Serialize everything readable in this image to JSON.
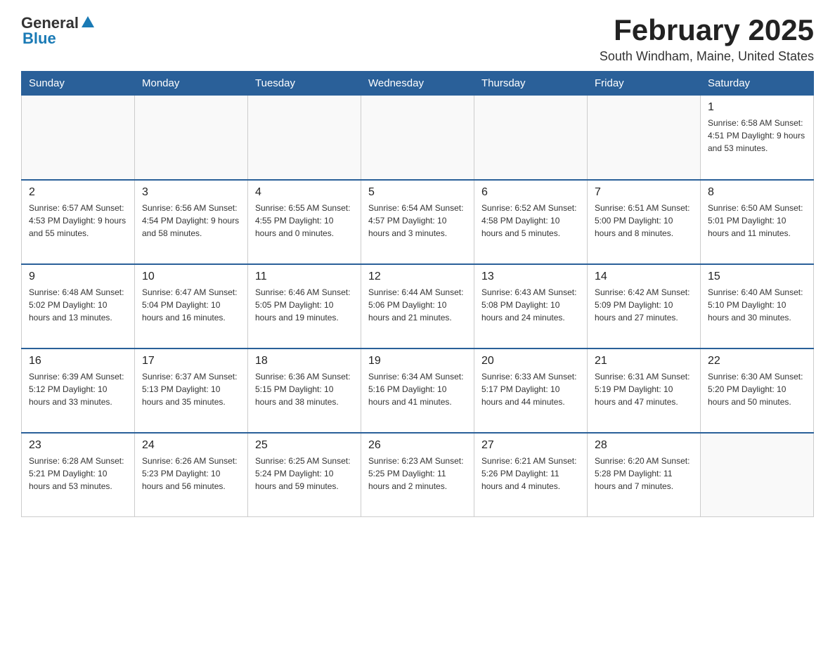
{
  "header": {
    "logo": {
      "general": "General",
      "blue": "Blue"
    },
    "title": "February 2025",
    "location": "South Windham, Maine, United States"
  },
  "calendar": {
    "days_of_week": [
      "Sunday",
      "Monday",
      "Tuesday",
      "Wednesday",
      "Thursday",
      "Friday",
      "Saturday"
    ],
    "weeks": [
      [
        {
          "day": "",
          "info": ""
        },
        {
          "day": "",
          "info": ""
        },
        {
          "day": "",
          "info": ""
        },
        {
          "day": "",
          "info": ""
        },
        {
          "day": "",
          "info": ""
        },
        {
          "day": "",
          "info": ""
        },
        {
          "day": "1",
          "info": "Sunrise: 6:58 AM\nSunset: 4:51 PM\nDaylight: 9 hours\nand 53 minutes."
        }
      ],
      [
        {
          "day": "2",
          "info": "Sunrise: 6:57 AM\nSunset: 4:53 PM\nDaylight: 9 hours\nand 55 minutes."
        },
        {
          "day": "3",
          "info": "Sunrise: 6:56 AM\nSunset: 4:54 PM\nDaylight: 9 hours\nand 58 minutes."
        },
        {
          "day": "4",
          "info": "Sunrise: 6:55 AM\nSunset: 4:55 PM\nDaylight: 10 hours\nand 0 minutes."
        },
        {
          "day": "5",
          "info": "Sunrise: 6:54 AM\nSunset: 4:57 PM\nDaylight: 10 hours\nand 3 minutes."
        },
        {
          "day": "6",
          "info": "Sunrise: 6:52 AM\nSunset: 4:58 PM\nDaylight: 10 hours\nand 5 minutes."
        },
        {
          "day": "7",
          "info": "Sunrise: 6:51 AM\nSunset: 5:00 PM\nDaylight: 10 hours\nand 8 minutes."
        },
        {
          "day": "8",
          "info": "Sunrise: 6:50 AM\nSunset: 5:01 PM\nDaylight: 10 hours\nand 11 minutes."
        }
      ],
      [
        {
          "day": "9",
          "info": "Sunrise: 6:48 AM\nSunset: 5:02 PM\nDaylight: 10 hours\nand 13 minutes."
        },
        {
          "day": "10",
          "info": "Sunrise: 6:47 AM\nSunset: 5:04 PM\nDaylight: 10 hours\nand 16 minutes."
        },
        {
          "day": "11",
          "info": "Sunrise: 6:46 AM\nSunset: 5:05 PM\nDaylight: 10 hours\nand 19 minutes."
        },
        {
          "day": "12",
          "info": "Sunrise: 6:44 AM\nSunset: 5:06 PM\nDaylight: 10 hours\nand 21 minutes."
        },
        {
          "day": "13",
          "info": "Sunrise: 6:43 AM\nSunset: 5:08 PM\nDaylight: 10 hours\nand 24 minutes."
        },
        {
          "day": "14",
          "info": "Sunrise: 6:42 AM\nSunset: 5:09 PM\nDaylight: 10 hours\nand 27 minutes."
        },
        {
          "day": "15",
          "info": "Sunrise: 6:40 AM\nSunset: 5:10 PM\nDaylight: 10 hours\nand 30 minutes."
        }
      ],
      [
        {
          "day": "16",
          "info": "Sunrise: 6:39 AM\nSunset: 5:12 PM\nDaylight: 10 hours\nand 33 minutes."
        },
        {
          "day": "17",
          "info": "Sunrise: 6:37 AM\nSunset: 5:13 PM\nDaylight: 10 hours\nand 35 minutes."
        },
        {
          "day": "18",
          "info": "Sunrise: 6:36 AM\nSunset: 5:15 PM\nDaylight: 10 hours\nand 38 minutes."
        },
        {
          "day": "19",
          "info": "Sunrise: 6:34 AM\nSunset: 5:16 PM\nDaylight: 10 hours\nand 41 minutes."
        },
        {
          "day": "20",
          "info": "Sunrise: 6:33 AM\nSunset: 5:17 PM\nDaylight: 10 hours\nand 44 minutes."
        },
        {
          "day": "21",
          "info": "Sunrise: 6:31 AM\nSunset: 5:19 PM\nDaylight: 10 hours\nand 47 minutes."
        },
        {
          "day": "22",
          "info": "Sunrise: 6:30 AM\nSunset: 5:20 PM\nDaylight: 10 hours\nand 50 minutes."
        }
      ],
      [
        {
          "day": "23",
          "info": "Sunrise: 6:28 AM\nSunset: 5:21 PM\nDaylight: 10 hours\nand 53 minutes."
        },
        {
          "day": "24",
          "info": "Sunrise: 6:26 AM\nSunset: 5:23 PM\nDaylight: 10 hours\nand 56 minutes."
        },
        {
          "day": "25",
          "info": "Sunrise: 6:25 AM\nSunset: 5:24 PM\nDaylight: 10 hours\nand 59 minutes."
        },
        {
          "day": "26",
          "info": "Sunrise: 6:23 AM\nSunset: 5:25 PM\nDaylight: 11 hours\nand 2 minutes."
        },
        {
          "day": "27",
          "info": "Sunrise: 6:21 AM\nSunset: 5:26 PM\nDaylight: 11 hours\nand 4 minutes."
        },
        {
          "day": "28",
          "info": "Sunrise: 6:20 AM\nSunset: 5:28 PM\nDaylight: 11 hours\nand 7 minutes."
        },
        {
          "day": "",
          "info": ""
        }
      ]
    ]
  }
}
